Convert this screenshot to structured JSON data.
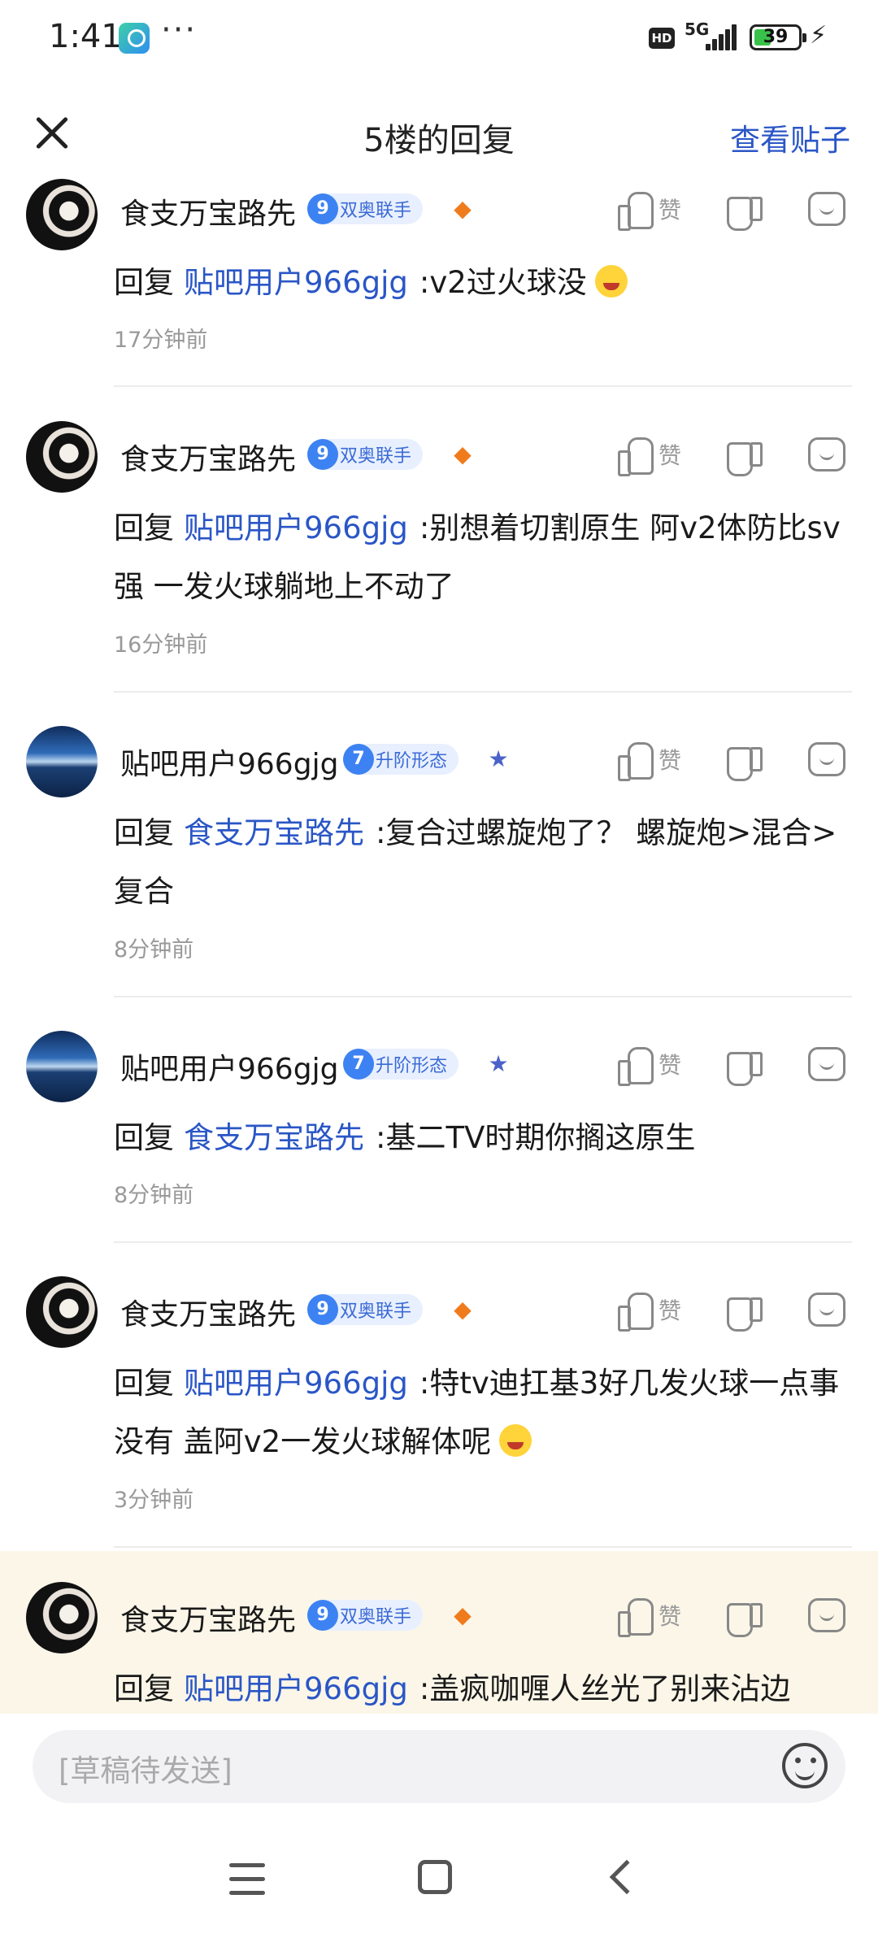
{
  "status_bar": {
    "time": "1:41",
    "dots": "···",
    "hd": "HD",
    "network": "5G",
    "battery": "39",
    "battery_level_percent": 39,
    "app_icon": "baidu-tieba-icon"
  },
  "header": {
    "title": "5楼的回复",
    "view_post": "查看贴子",
    "close_icon": "close-icon"
  },
  "actions": {
    "like_label": "赞"
  },
  "replies": [
    {
      "username": "食支万宝路先",
      "level": "9",
      "badge": "双奥联手",
      "reply_word": "回复",
      "target": "贴吧用户966gjg",
      "text": ":v2过火球没",
      "time": "17分钟前"
    },
    {
      "username": "食支万宝路先",
      "level": "9",
      "badge": "双奥联手",
      "reply_word": "回复",
      "target": "贴吧用户966gjg",
      "text": ":别想着切割原生 阿v2体防比sv强 一发火球躺地上不动了",
      "time": "16分钟前"
    },
    {
      "username": "贴吧用户966gjg",
      "level": "7",
      "badge": "升阶形态",
      "reply_word": "回复",
      "target": "食支万宝路先",
      "text": ":复合过螺旋炮了？ 螺旋炮>混合>复合",
      "time": "8分钟前"
    },
    {
      "username": "贴吧用户966gjg",
      "level": "7",
      "badge": "升阶形态",
      "reply_word": "回复",
      "target": "食支万宝路先",
      "text": ":基二TV时期你搁这原生",
      "time": "8分钟前"
    },
    {
      "username": "食支万宝路先",
      "level": "9",
      "badge": "双奥联手",
      "reply_word": "回复",
      "target": "贴吧用户966gjg",
      "text": ":特tv迪扛基3好几发火球一点事没有 盖阿v2一发火球解体呢",
      "time": "3分钟前"
    },
    {
      "username": "食支万宝路先",
      "level": "9",
      "badge": "双奥联手",
      "reply_word": "回复",
      "target": "贴吧用户966gjg",
      "text": ":盖疯咖喱人丝光了别来沾边",
      "time": ""
    }
  ],
  "input": {
    "placeholder": "[草稿待发送]",
    "emoji_icon": "smiley-icon"
  },
  "nav": {
    "menu_icon": "menu-icon",
    "home_icon": "home-icon",
    "back_icon": "back-icon"
  }
}
